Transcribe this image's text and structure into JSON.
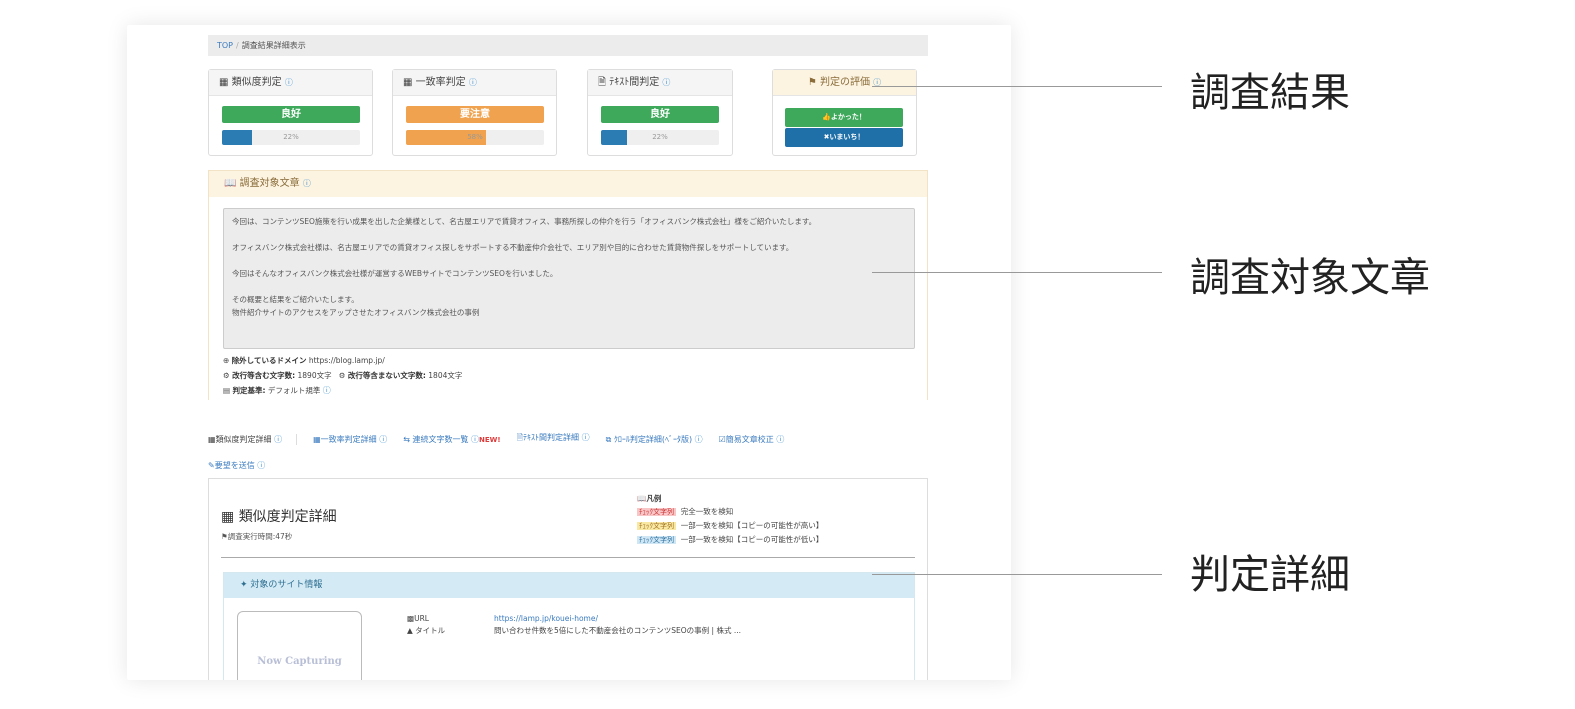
{
  "breadcrumb": {
    "top": "TOP",
    "separator": "/",
    "current": "調査結果詳細表示"
  },
  "panels": {
    "similarity": {
      "title": "類似度判定",
      "verdict": "良好",
      "percent_label": "22%",
      "fill": 0.22,
      "status": "ok"
    },
    "match": {
      "title": "一致率判定",
      "verdict": "要注意",
      "percent_label": "58%",
      "fill": 0.58,
      "status": "warn"
    },
    "text": {
      "title": "ﾃｷｽﾄ間判定",
      "verdict": "良好",
      "percent_label": "22%",
      "fill": 0.22,
      "status": "ok"
    },
    "evaluation": {
      "title": "判定の評価",
      "good_button": "よかった！",
      "bad_button": "いまいち！"
    }
  },
  "target": {
    "title": "調査対象文章",
    "paragraphs": [
      "今回は、コンテンツSEO施策を行い成果を出した企業様として、名古屋エリアで賃貸オフィス、事務所探しの仲介を行う「オフィスバンク株式会社」様をご紹介いたします。",
      "オフィスバンク株式会社様は、名古屋エリアでの賃貸オフィス探しをサポートする不動産仲介会社で、エリア別や目的に合わせた賃貸物件探しをサポートしています。",
      "今回はそんなオフィスバンク株式会社様が運営するWEBサイトでコンテンツSEOを行いました。",
      "その概要と結果をご紹介いたします。\n物件紹介サイトのアクセスをアップさせたオフィスバンク株式会社の事例"
    ],
    "excluded_domain_label": "除外しているドメイン",
    "excluded_domain": "https://blog.lamp.jp/",
    "chars_with_breaks_label": "改行等含む文字数:",
    "chars_with_breaks": "1890文字",
    "chars_without_breaks_label": "改行等含まない文字数:",
    "chars_without_breaks": "1804文字",
    "criteria_label": "判定基準:",
    "criteria": "デフォルト規準"
  },
  "tabs": {
    "items": [
      "類似度判定詳細",
      "一致率判定詳細",
      "連続文字数一覧",
      "ﾃｷｽﾄ間判定詳細",
      "ｸﾛｰﾙ判定詳細(ﾍﾞｰﾀ版)",
      "簡易文章校正"
    ],
    "new_badge": "NEW!",
    "request": "要望を送信"
  },
  "detail": {
    "title": "類似度判定詳細",
    "time": "調査実行時間:47秒",
    "legend_title": "凡例",
    "legend": [
      {
        "tag": "ﾁｪｯｸ文字列",
        "text": "完全一致を検知",
        "color": "red"
      },
      {
        "tag": "ﾁｪｯｸ文字列",
        "text": "一部一致を検知【コピーの可能性が高い】",
        "color": "yellow"
      },
      {
        "tag": "ﾁｪｯｸ文字列",
        "text": "一部一致を検知【コピーの可能性が低い】",
        "color": "blue"
      }
    ],
    "site_header": "対象のサイト情報",
    "thumbnail_text": "Now Capturing",
    "url_label": "URL",
    "url": "https://lamp.jp/kouei-home/",
    "title_label": "タイトル",
    "page_title": "問い合わせ件数を5倍にした不動産会社のコンテンツSEOの事例 | 株式 ..."
  },
  "callouts": {
    "result": "調査結果",
    "target": "調査対象文章",
    "detail": "判定詳細"
  },
  "colors": {
    "ok": "#3ea85b",
    "warn": "#f0a24e",
    "bar": "#2b7cb3",
    "eval_good": "#3ea85b",
    "eval_bad": "#1f6fa8"
  }
}
